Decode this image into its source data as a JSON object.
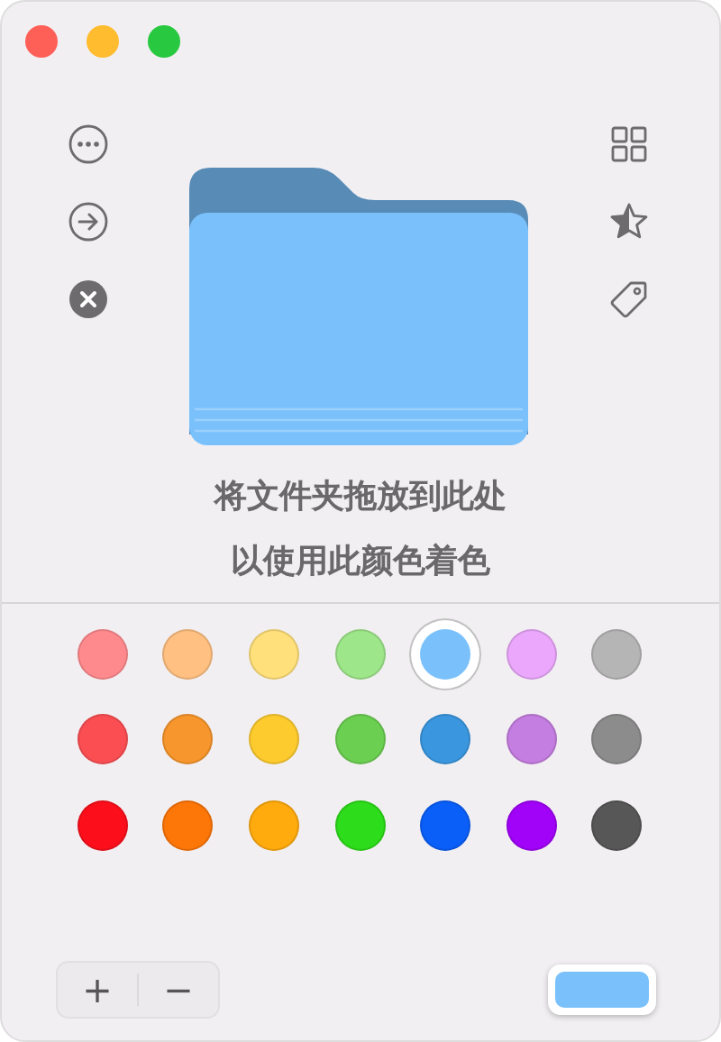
{
  "window": {
    "controls": [
      {
        "color": "#fe5f57"
      },
      {
        "color": "#febc2e"
      },
      {
        "color": "#28c840"
      }
    ]
  },
  "drop_hint": [
    "将文件夹拖放到此处",
    "以使用此颜色着色"
  ],
  "swatches": [
    [
      {
        "color": "#ff8a8e",
        "selected": false
      },
      {
        "color": "#ffc081",
        "selected": false
      },
      {
        "color": "#ffe07a",
        "selected": false
      },
      {
        "color": "#9ee68a",
        "selected": false
      },
      {
        "color": "#7ac1fc",
        "selected": true
      },
      {
        "color": "#eaa7fb",
        "selected": false
      },
      {
        "color": "#b5b5b5",
        "selected": false
      }
    ],
    [
      {
        "color": "#fb4e52",
        "selected": false
      },
      {
        "color": "#f7962c",
        "selected": false
      },
      {
        "color": "#fdcb2d",
        "selected": false
      },
      {
        "color": "#6bcf51",
        "selected": false
      },
      {
        "color": "#3a97df",
        "selected": false
      },
      {
        "color": "#c47de0",
        "selected": false
      },
      {
        "color": "#8c8c8c",
        "selected": false
      }
    ],
    [
      {
        "color": "#fc0f1b",
        "selected": false
      },
      {
        "color": "#fd7608",
        "selected": false
      },
      {
        "color": "#ffab0d",
        "selected": false
      },
      {
        "color": "#2ddc1a",
        "selected": false
      },
      {
        "color": "#0a5ff8",
        "selected": false
      },
      {
        "color": "#a102f8",
        "selected": false
      },
      {
        "color": "#575757",
        "selected": false
      }
    ]
  ],
  "bottom_bar": {
    "buttons": [
      "+",
      "−"
    ]
  }
}
